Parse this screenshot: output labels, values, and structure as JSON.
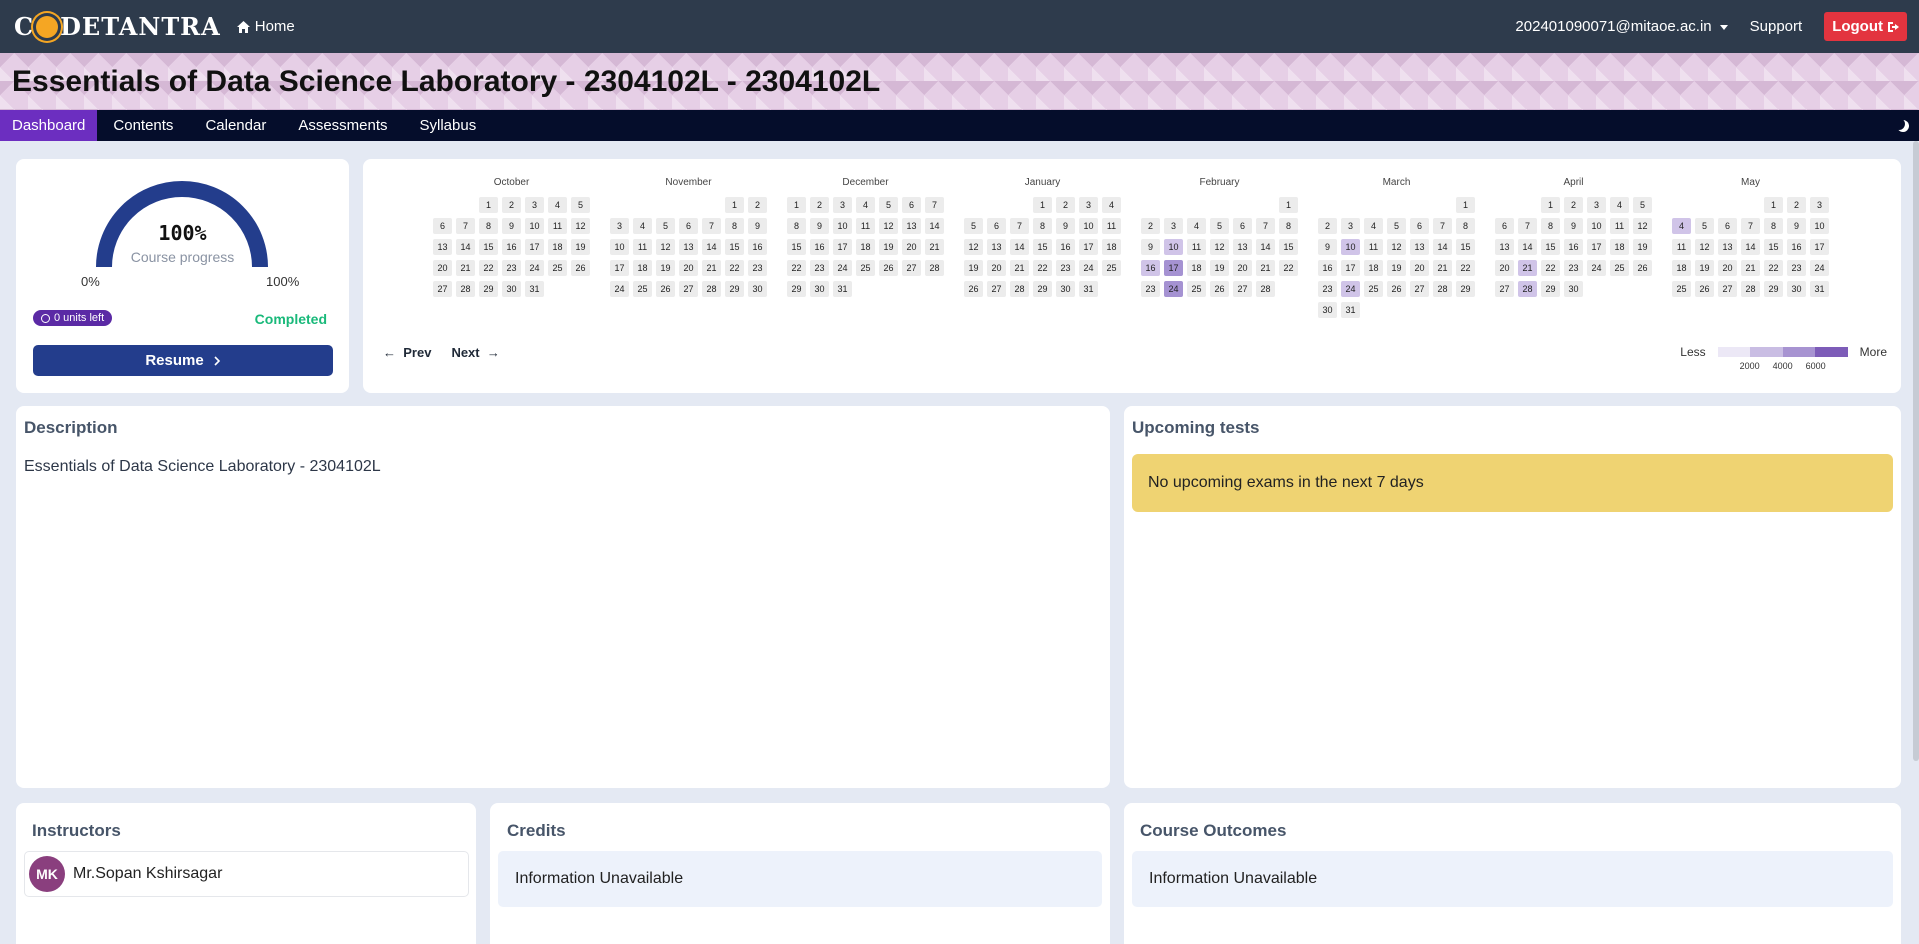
{
  "topbar": {
    "logo": "CODETANTRA",
    "home": "Home",
    "user_email": "202401090071@mitaoe.ac.in",
    "support": "Support",
    "logout": "Logout"
  },
  "banner": {
    "title": "Essentials of Data Science Laboratory - 2304102L - 2304102L"
  },
  "nav": {
    "items": [
      "Dashboard",
      "Contents",
      "Calendar",
      "Assessments",
      "Syllabus"
    ],
    "active": "Dashboard"
  },
  "progress": {
    "value_text": "100%",
    "value": 100,
    "label": "Course progress",
    "min": "0%",
    "max": "100%",
    "units_left": "0 units left",
    "status": "Completed",
    "resume": "Resume",
    "colors": {
      "gauge": "#233d8c",
      "status": "#19b97a",
      "badge": "#5b2aa5"
    }
  },
  "heatmap": {
    "months": [
      {
        "name": "October",
        "offset": 2,
        "days": 31,
        "active": {}
      },
      {
        "name": "November",
        "offset": 5,
        "days": 30,
        "active": {}
      },
      {
        "name": "December",
        "offset": 0,
        "days": 31,
        "active": {}
      },
      {
        "name": "January",
        "offset": 3,
        "days": 31,
        "active": {}
      },
      {
        "name": "February",
        "offset": 6,
        "days": 28,
        "active": {
          "10": 1,
          "16": 1,
          "17": 2,
          "24": 2
        }
      },
      {
        "name": "March",
        "offset": 6,
        "days": 31,
        "active": {
          "10": 1,
          "24": 1
        }
      },
      {
        "name": "April",
        "offset": 2,
        "days": 30,
        "active": {
          "21": 1,
          "28": 1
        }
      },
      {
        "name": "May",
        "offset": 4,
        "days": 31,
        "active": {
          "4": 1
        }
      }
    ],
    "prev": "Prev",
    "next": "Next",
    "legend": {
      "less": "Less",
      "more": "More",
      "ticks": [
        "2000",
        "4000",
        "6000"
      ],
      "colors": [
        "#ece8f6",
        "#c9bde3",
        "#a793d1",
        "#7d5cb8"
      ]
    }
  },
  "description": {
    "title": "Description",
    "text": "Essentials of Data Science Laboratory - 2304102L"
  },
  "upcoming": {
    "title": "Upcoming tests",
    "message": "No upcoming exams in the next 7 days"
  },
  "instructors": {
    "title": "Instructors",
    "list": [
      {
        "initials": "MK",
        "name": "Mr.Sopan Kshirsagar"
      }
    ]
  },
  "credits": {
    "title": "Credits",
    "text": "Information Unavailable"
  },
  "outcomes": {
    "title": "Course Outcomes",
    "text": "Information Unavailable"
  }
}
